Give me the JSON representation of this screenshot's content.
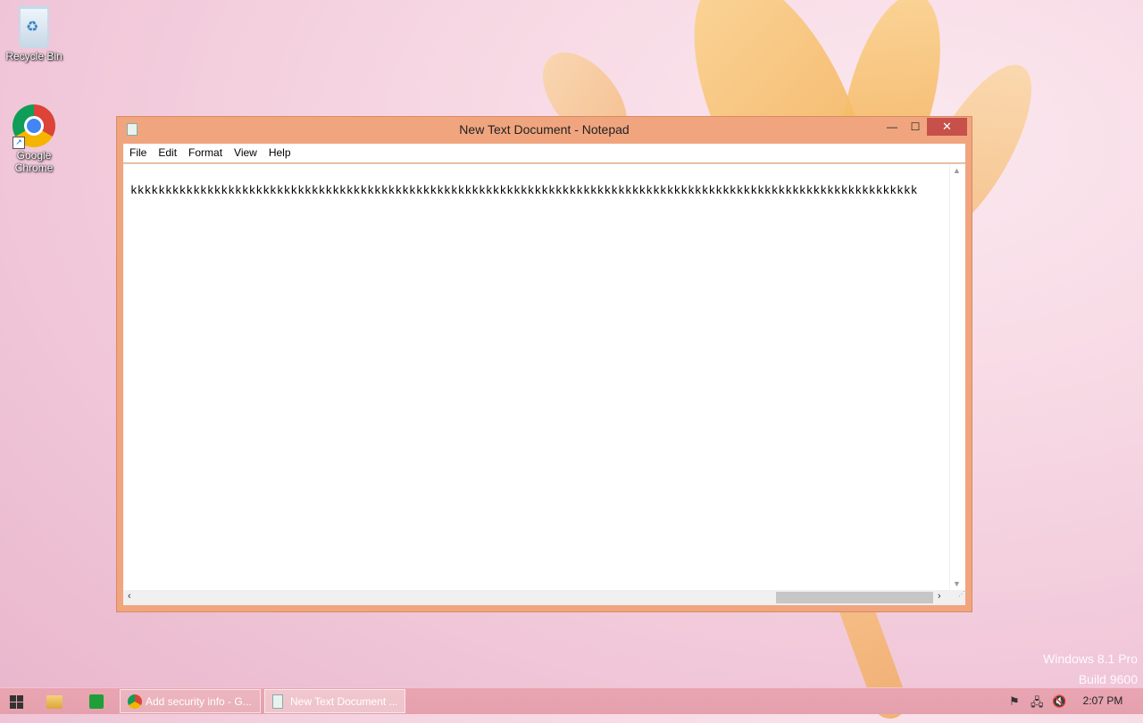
{
  "desktop": {
    "icons": [
      {
        "label": "Recycle Bin",
        "icon": "recycle-bin-icon"
      },
      {
        "label": "Google Chrome",
        "icon": "chrome-icon"
      }
    ],
    "watermark": {
      "line1": "Windows 8.1 Pro",
      "line2": "Build 9600"
    }
  },
  "notepad": {
    "title": "New Text Document - Notepad",
    "controls": {
      "minimize": "—",
      "maximize": "☐",
      "close": "✕"
    },
    "menu": [
      "File",
      "Edit",
      "Format",
      "View",
      "Help"
    ],
    "content": "kkkkkkkkkkkkkkkkkkkkkkkkkkkkkkkkkkkkkkkkkkkkkkkkkkkkkkkkkkkkkkkkkkkkkkkkkkkkkkkkkkkkkkkkkkkkkkkkkkkkkkkkkkkkkkkkk"
  },
  "taskbar": {
    "tasks": [
      {
        "label": "Add security info - G...",
        "icon": "chrome-icon",
        "active": false
      },
      {
        "label": "New Text Document ...",
        "icon": "notepad-icon",
        "active": true
      }
    ],
    "clock": "2:07 PM"
  }
}
